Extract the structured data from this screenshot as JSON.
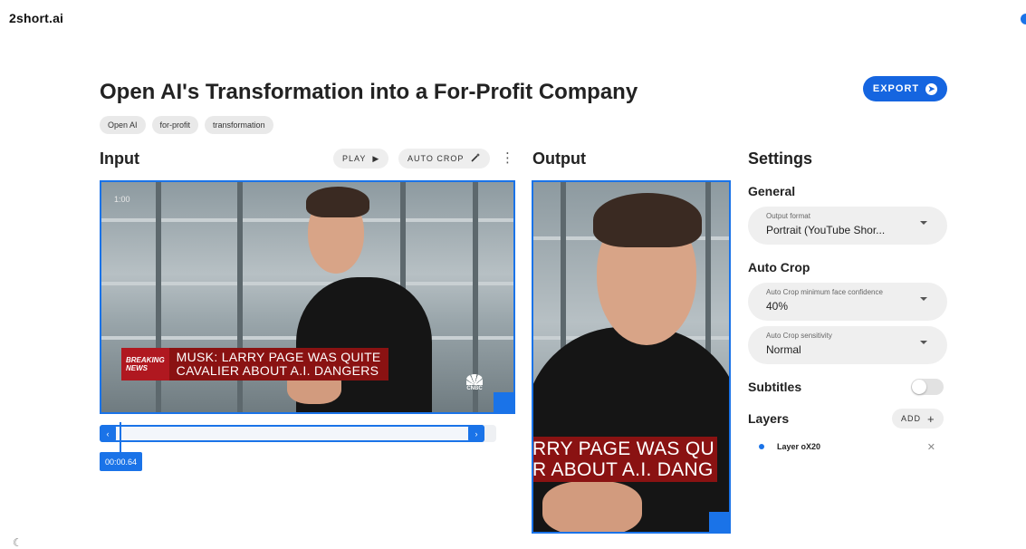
{
  "brand": "2short.ai",
  "page_title": "Open AI's Transformation into a For-Profit Company",
  "export_label": "EXPORT",
  "tags": [
    "Open AI",
    "for-profit",
    "transformation"
  ],
  "input": {
    "heading": "Input",
    "play_label": "PLAY",
    "autocrop_label": "AUTO CROP",
    "timestamp": "1:00",
    "breaking_top": "BREAKING",
    "breaking_bottom": "NEWS",
    "headline_line1": "MUSK: LARRY PAGE WAS QUITE",
    "headline_line2": "CAVALIER ABOUT A.I. DANGERS",
    "channel_logo": "CNBC"
  },
  "timeline": {
    "current_time": "00:00.64",
    "left_handle": "‹",
    "right_handle": "›"
  },
  "output": {
    "heading": "Output",
    "headline_line1": "RRY PAGE WAS QU",
    "headline_line2": "R ABOUT A.I. DANG"
  },
  "settings": {
    "heading": "Settings",
    "general": {
      "heading": "General",
      "output_format_label": "Output format",
      "output_format_value": "Portrait (YouTube Shor..."
    },
    "auto_crop": {
      "heading": "Auto Crop",
      "confidence_label": "Auto Crop minimum face confidence",
      "confidence_value": "40%",
      "sensitivity_label": "Auto Crop sensitivity",
      "sensitivity_value": "Normal"
    },
    "subtitles": {
      "heading": "Subtitles",
      "enabled": false
    },
    "layers": {
      "heading": "Layers",
      "add_label": "ADD",
      "items": [
        {
          "name": "Layer oX20"
        }
      ]
    }
  },
  "colors": {
    "accent": "#1a73e8",
    "export_bg": "#1565e0",
    "breaking_red": "#b01820",
    "headline_red": "#8a1212"
  },
  "icons": {
    "export": "arrow-right-circle-icon",
    "play": "play-triangle-icon",
    "autocrop": "magic-wand-icon",
    "more": "kebab-menu-icon",
    "theme": "moon-icon",
    "close": "close-icon"
  }
}
